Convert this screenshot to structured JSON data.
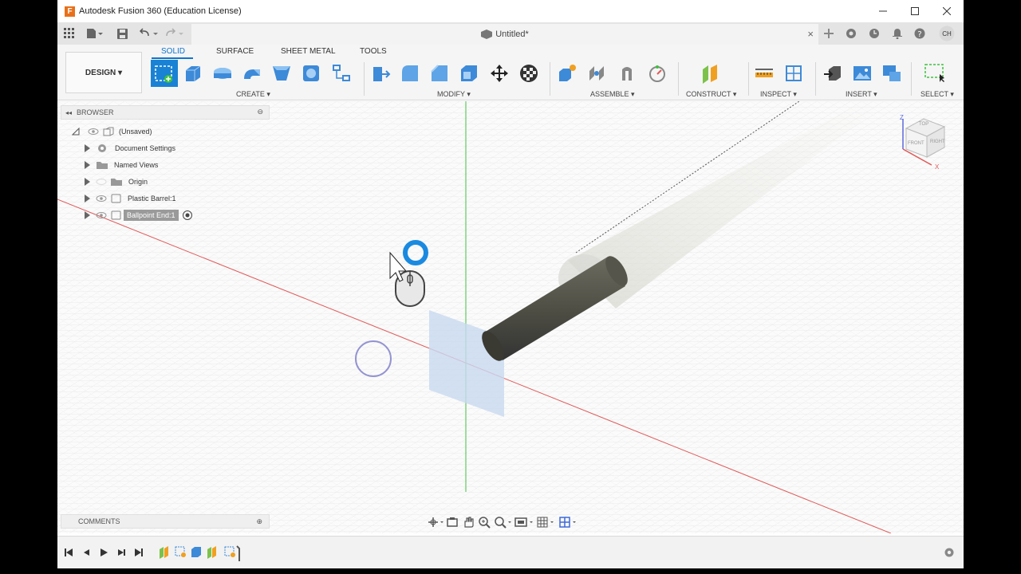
{
  "window": {
    "title": "Autodesk Fusion 360 (Education License)",
    "logo_letter": "F"
  },
  "document": {
    "tab_title": "Untitled*",
    "user_initials": "CH"
  },
  "workspace": {
    "label": "DESIGN ▾"
  },
  "ribbon": {
    "tabs": [
      {
        "label": "SOLID",
        "active": true
      },
      {
        "label": "SURFACE",
        "active": false
      },
      {
        "label": "SHEET METAL",
        "active": false
      },
      {
        "label": "TOOLS",
        "active": false
      }
    ],
    "groups": {
      "create": "CREATE ▾",
      "modify": "MODIFY ▾",
      "assemble": "ASSEMBLE ▾",
      "construct": "CONSTRUCT ▾",
      "inspect": "INSPECT ▾",
      "insert": "INSERT ▾",
      "select": "SELECT ▾"
    }
  },
  "browser": {
    "header": "BROWSER",
    "root": "(Unsaved)",
    "items": [
      {
        "label": "Document Settings",
        "icon": "gear-icon"
      },
      {
        "label": "Named Views",
        "icon": "folder-icon"
      },
      {
        "label": "Origin",
        "icon": "folder-icon"
      },
      {
        "label": "Plastic Barrel:1",
        "icon": "component-icon"
      },
      {
        "label": "Ballpoint End:1",
        "icon": "component-icon",
        "active": true
      }
    ]
  },
  "comments": {
    "header": "COMMENTS"
  },
  "viewcube": {
    "top": "TOP",
    "front": "FRONT",
    "right": "RIGHT",
    "z": "Z",
    "x": "X"
  },
  "colors": {
    "accent": "#0f74d0",
    "x_axis": "#e05a5a",
    "y_axis": "#45c045",
    "body": "#4f4f45"
  }
}
